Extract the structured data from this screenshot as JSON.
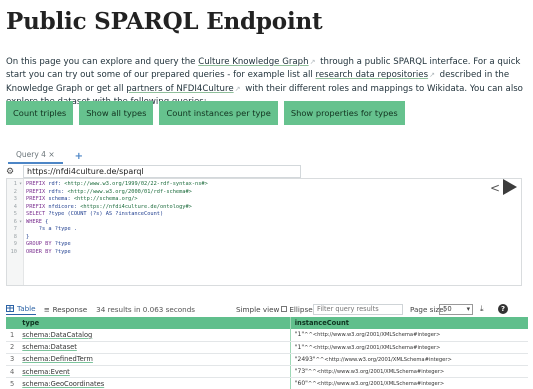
{
  "page": {
    "title": "Public SPARQL Endpoint",
    "intro": {
      "t1": "On this page you can explore and query the ",
      "link1": "Culture Knowledge Graph",
      "t2": " through a public SPARQL interface. For a quick start you can try out some of our prepared queries -  for example list all ",
      "link2": "research data repositories",
      "t3": " described in the Knowledge Graph or get all ",
      "link3": "partners of NFDI4Culture",
      "t4": " with their different roles and mappings to Wikidata. You can also explore the dataset with the following queries:",
      "ext_icon": "external-link-icon"
    }
  },
  "query_buttons": [
    "Count triples",
    "Show all types",
    "Count instances per type",
    "Show properties for types"
  ],
  "editor": {
    "tab_label": "Query 4",
    "tab_close": "×",
    "add_tab": "+",
    "endpoint": "https://nfdi4culture.de/sparql",
    "lines": [
      {
        "n": "1",
        "f": "▾",
        "k": "PREFIX",
        "v": " rdf:",
        "u": " <http://www.w3.org/1999/02/22-rdf-syntax-ns#>"
      },
      {
        "n": "2",
        "f": "",
        "k": "PREFIX",
        "v": " rdfs:",
        "u": " <http://www.w3.org/2000/01/rdf-schema#>"
      },
      {
        "n": "3",
        "f": "",
        "k": "PREFIX",
        "v": " schema:",
        "u": " <http://schema.org/>"
      },
      {
        "n": "4",
        "f": "",
        "k": "PREFIX",
        "v": " nfdicore:",
        "u": " <https://nfdi4culture.de/ontology#>"
      },
      {
        "n": "5",
        "f": "",
        "k": "SELECT",
        "v": " ?type (COUNT (?s) AS ?instanceCount)",
        "u": ""
      },
      {
        "n": "6",
        "f": "▾",
        "k": "WHERE",
        "v": " {",
        "u": ""
      },
      {
        "n": "7",
        "f": "",
        "k": "",
        "v": "    ?s a ?type .",
        "u": ""
      },
      {
        "n": "8",
        "f": "",
        "k": "",
        "v": "}",
        "u": ""
      },
      {
        "n": "9",
        "f": "",
        "k": "GROUP BY",
        "v": " ?type",
        "u": ""
      },
      {
        "n": "10",
        "f": "",
        "k": "ORDER BY",
        "v": " ?type",
        "u": ""
      }
    ],
    "share_icon": "share-icon",
    "run_icon": "play-icon"
  },
  "results": {
    "tab_table": "Table",
    "tab_response": "Response",
    "summary": "34 results in 0.063 seconds",
    "simple_view": "Simple view",
    "ellipse": "Ellipse",
    "filter_placeholder": "Filter query results",
    "page_size_label": "Page size:",
    "page_size": "50",
    "columns": [
      "type",
      "instanceCount"
    ],
    "rows": [
      {
        "i": "1",
        "type": "schema:DataCatalog",
        "count": "\"1\"",
        "dt": "^^<http://www.w3.org/2001/XMLSchema#integer>"
      },
      {
        "i": "2",
        "type": "schema:Dataset",
        "count": "\"1\"",
        "dt": "^^<http://www.w3.org/2001/XMLSchema#integer>"
      },
      {
        "i": "3",
        "type": "schema:DefinedTerm",
        "count": "\"2493\"",
        "dt": "^^<http://www.w3.org/2001/XMLSchema#integer>"
      },
      {
        "i": "4",
        "type": "schema:Event",
        "count": "\"73\"",
        "dt": "^^<http://www.w3.org/2001/XMLSchema#integer>"
      },
      {
        "i": "5",
        "type": "schema:GeoCoordinates",
        "count": "\"60\"",
        "dt": "^^<http://www.w3.org/2001/XMLSchema#integer>"
      }
    ]
  },
  "colors": {
    "accent": "#66c28e",
    "header": "#60bf8c",
    "link_blue": "#2c63a6"
  }
}
